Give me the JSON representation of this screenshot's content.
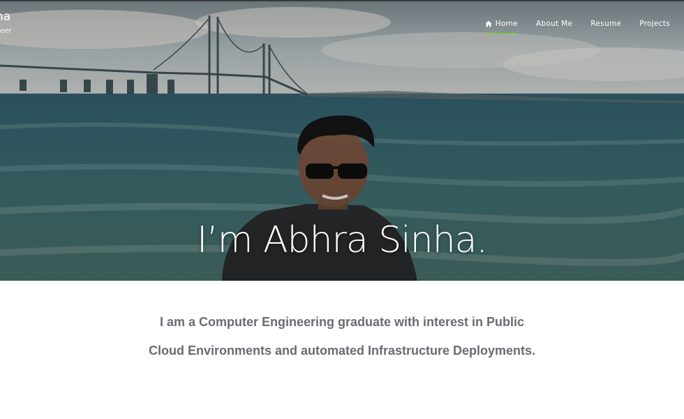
{
  "brand": {
    "name": "na",
    "subtitle": "eer"
  },
  "nav": {
    "items": [
      {
        "label": "Home",
        "icon": "home-icon",
        "active": true
      },
      {
        "label": "About Me"
      },
      {
        "label": "Resume"
      },
      {
        "label": "Projects"
      }
    ]
  },
  "hero": {
    "title": "I’m Abhra Sinha."
  },
  "intro": {
    "text": "I am a Computer Engineering graduate with interest in Public Cloud Environments and automated Infrastructure Deployments."
  },
  "colors": {
    "nav_active_underline": "#88c34a",
    "intro_text": "#6b6b73"
  }
}
